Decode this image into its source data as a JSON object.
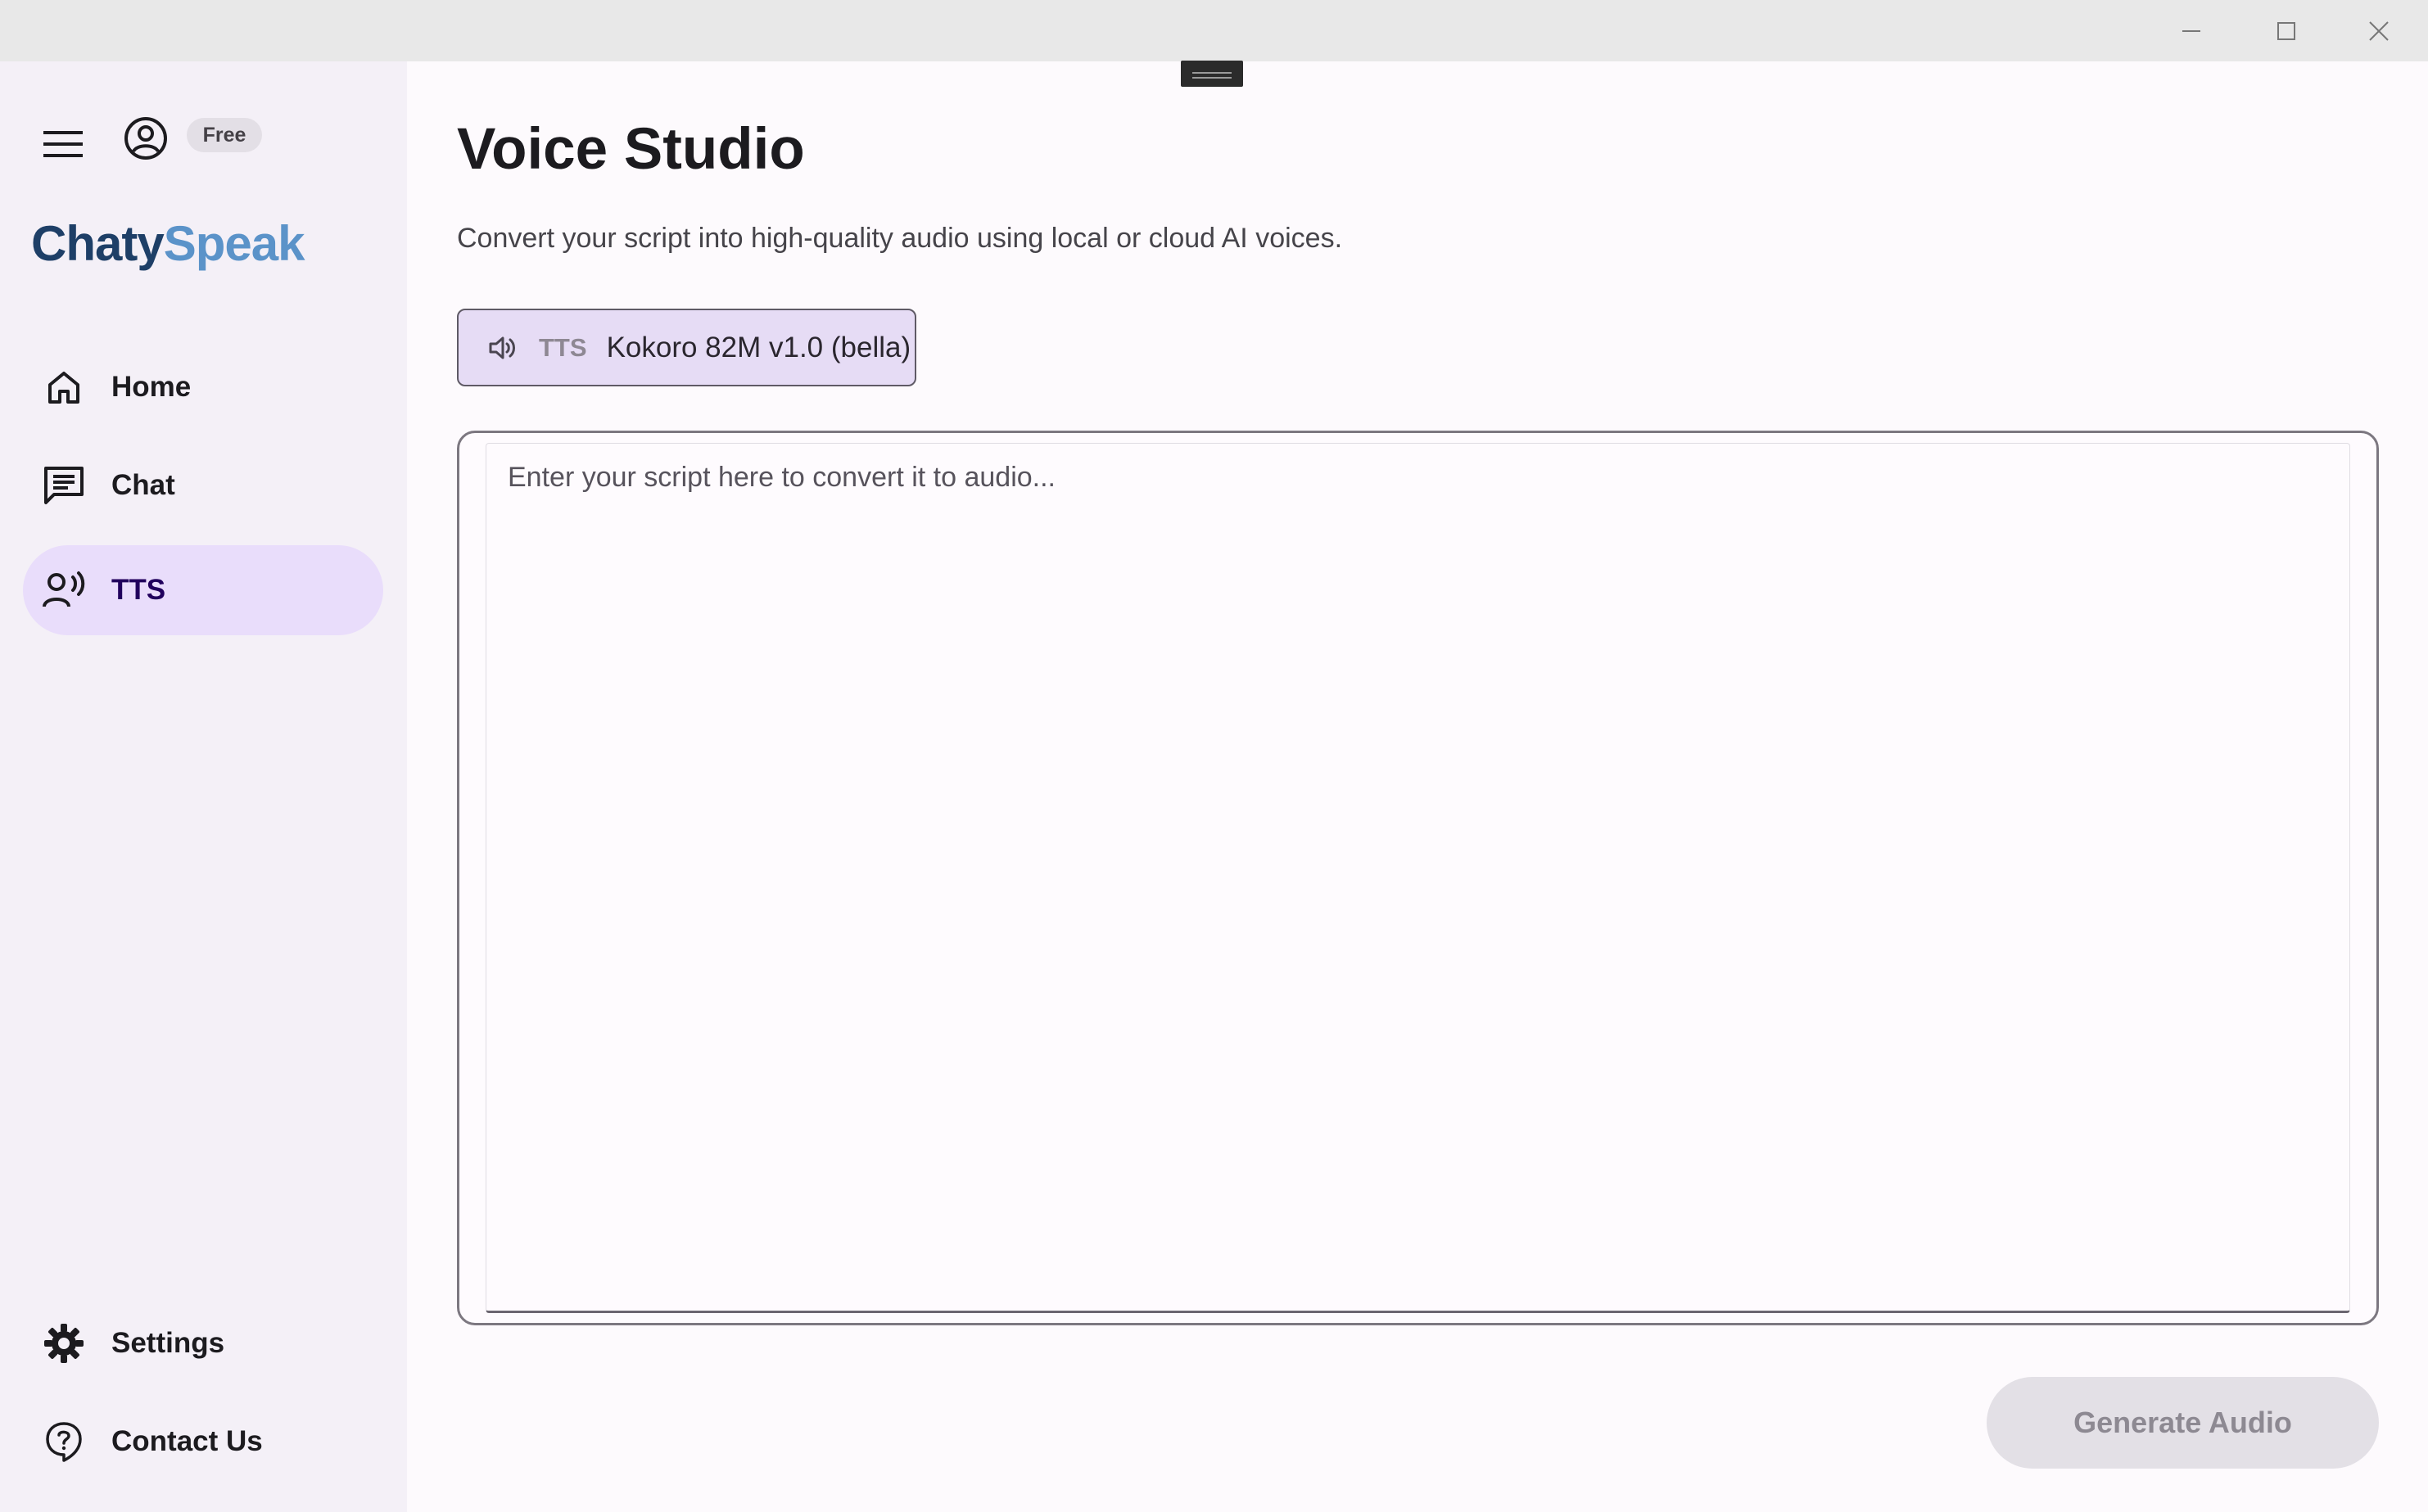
{
  "window": {
    "controls": {
      "minimize_icon": "minimize-icon",
      "maximize_icon": "maximize-icon",
      "close_icon": "close-icon"
    }
  },
  "sidebar": {
    "plan_badge": "Free",
    "logo": {
      "part1": "Chaty",
      "part2": "Speak"
    },
    "items": [
      {
        "label": "Home",
        "icon": "home-icon",
        "active": false
      },
      {
        "label": "Chat",
        "icon": "chat-icon",
        "active": false
      },
      {
        "label": "TTS",
        "icon": "voice-icon",
        "active": true
      }
    ],
    "bottom_items": [
      {
        "label": "Settings",
        "icon": "gear-icon"
      },
      {
        "label": "Contact Us",
        "icon": "help-icon"
      }
    ]
  },
  "main": {
    "title": "Voice Studio",
    "subtitle": "Convert your script into high-quality audio using local or cloud AI voices.",
    "model_chip": {
      "tag": "TTS",
      "label": "Kokoro 82M v1.0 (bella)",
      "icon": "speaker-icon"
    },
    "script": {
      "value": "",
      "placeholder": "Enter your script here to convert it to audio..."
    },
    "generate_button": "Generate Audio"
  },
  "colors": {
    "sidebar_bg": "#f4f0f7",
    "active_nav_bg": "#e9ddfb",
    "chip_bg": "#e6dcf5",
    "logo_dark": "#1e3f67",
    "logo_light": "#5b93c9",
    "disabled_button_bg": "#e3e0e6"
  }
}
